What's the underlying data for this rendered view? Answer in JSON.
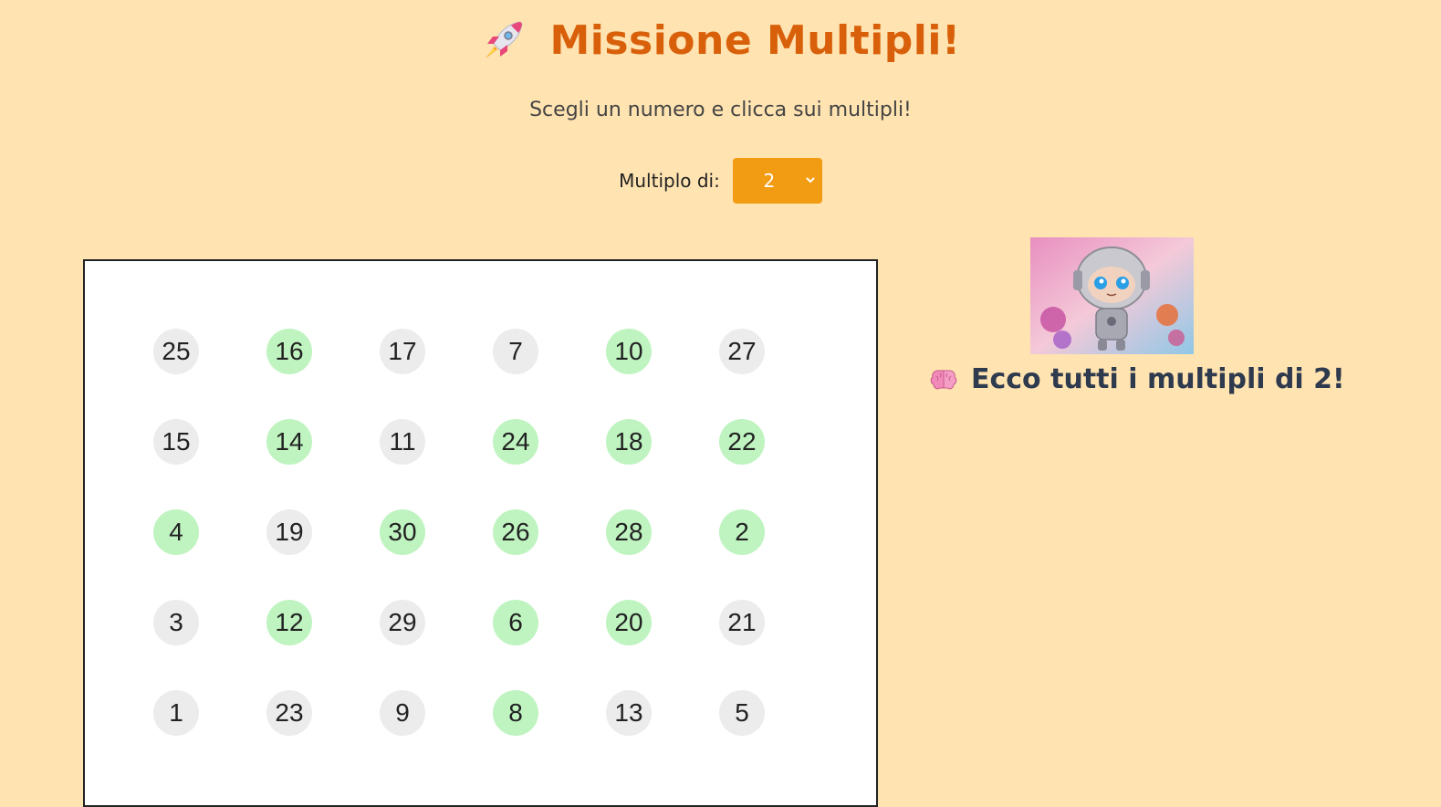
{
  "header": {
    "rocket_icon": "rocket-icon",
    "title": "Missione Multipli!"
  },
  "subtitle": "Scegli un numero e clicca sui multipli!",
  "controls": {
    "label": "Multiplo di:",
    "selected": "2"
  },
  "board": {
    "rows": [
      [
        {
          "n": "25",
          "hit": false
        },
        {
          "n": "16",
          "hit": true
        },
        {
          "n": "17",
          "hit": false
        },
        {
          "n": "7",
          "hit": false
        },
        {
          "n": "10",
          "hit": true
        },
        {
          "n": "27",
          "hit": false
        }
      ],
      [
        {
          "n": "15",
          "hit": false
        },
        {
          "n": "14",
          "hit": true
        },
        {
          "n": "11",
          "hit": false
        },
        {
          "n": "24",
          "hit": true
        },
        {
          "n": "18",
          "hit": true
        },
        {
          "n": "22",
          "hit": true
        }
      ],
      [
        {
          "n": "4",
          "hit": true
        },
        {
          "n": "19",
          "hit": false
        },
        {
          "n": "30",
          "hit": true
        },
        {
          "n": "26",
          "hit": true
        },
        {
          "n": "28",
          "hit": true
        },
        {
          "n": "2",
          "hit": true
        }
      ],
      [
        {
          "n": "3",
          "hit": false
        },
        {
          "n": "12",
          "hit": true
        },
        {
          "n": "29",
          "hit": false
        },
        {
          "n": "6",
          "hit": true
        },
        {
          "n": "20",
          "hit": true
        },
        {
          "n": "21",
          "hit": false
        }
      ],
      [
        {
          "n": "1",
          "hit": false
        },
        {
          "n": "23",
          "hit": false
        },
        {
          "n": "9",
          "hit": false
        },
        {
          "n": "8",
          "hit": true
        },
        {
          "n": "13",
          "hit": false
        },
        {
          "n": "5",
          "hit": false
        }
      ]
    ]
  },
  "result": {
    "icon": "brain-icon",
    "text": "Ecco tutti i multipli di 2!"
  },
  "colors": {
    "background": "#ffe3b0",
    "title": "#d9600a",
    "select": "#f29c14",
    "multiple": "#bff4c0",
    "cell": "#ececec"
  }
}
